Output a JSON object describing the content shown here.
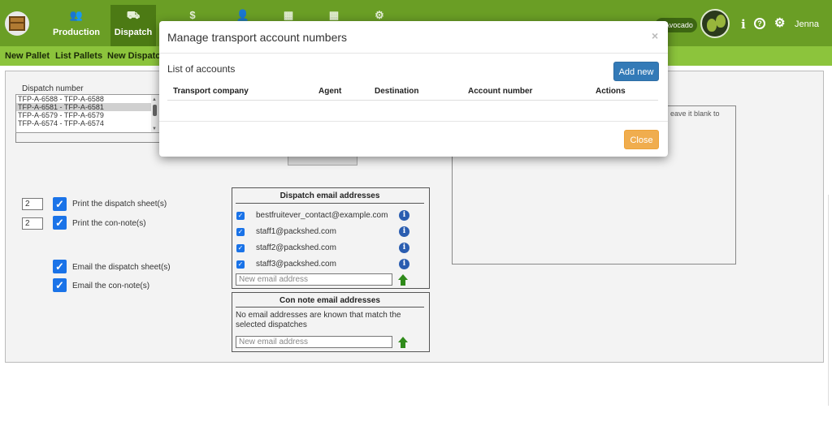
{
  "nav": {
    "items": [
      {
        "label": "Production",
        "icon": "users-icon"
      },
      {
        "label": "Dispatch",
        "icon": "truck-icon"
      },
      {
        "label": "",
        "icon": "dollar-icon"
      },
      {
        "label": "",
        "icon": "person-icon"
      },
      {
        "label": "",
        "icon": "calendar-icon"
      },
      {
        "label": "",
        "icon": "grid-icon"
      },
      {
        "label": "",
        "icon": "gear-icon"
      }
    ],
    "glyphs": [
      "👥",
      "⛟",
      "$",
      "👤",
      "▦",
      "▦",
      "⚙"
    ],
    "vendor": "Avocado",
    "user": "Jenna",
    "icons": {
      "info": "i",
      "help": "?",
      "settings": "⚙"
    }
  },
  "subnav": {
    "new_pallet": "New Pallet",
    "list_pallets": "List Pallets",
    "new_dispatch": "New Dispatch"
  },
  "main": {
    "dispatch_label": "Dispatch number",
    "dispatch_options": [
      "TFP-A-6588 - TFP-A-6588",
      "TFP-A-6581 - TFP-A-6581",
      "TFP-A-6579 - TFP-A-6579",
      "TFP-A-6574 - TFP-A-6574"
    ],
    "print_dispatch_copies": "2",
    "print_dispatch_label": "Print the dispatch sheet(s)",
    "print_connote_copies": "2",
    "print_connote_label": "Print the con-note(s)",
    "email_dispatch_label": "Email the dispatch sheet(s)",
    "email_connote_label": "Email the con-note(s)",
    "dispatch_emails_title": "Dispatch email addresses",
    "dispatch_emails": [
      "bestfruitever_contact@example.com",
      "staff1@packshed.com",
      "staff2@packshed.com",
      "staff3@packshed.com"
    ],
    "new_email_placeholder": "New email address",
    "connote_emails_title": "Con note email addresses",
    "connote_none_msg": "No email addresses are known that match the selected dispatches",
    "right_hint": "eave it blank to"
  },
  "modal": {
    "title": "Manage transport account numbers",
    "close_x": "×",
    "list_title": "List of accounts",
    "add_label": "Add new",
    "columns": [
      "Transport company",
      "Agent",
      "Destination",
      "Account number",
      "Actions"
    ],
    "close_label": "Close"
  }
}
